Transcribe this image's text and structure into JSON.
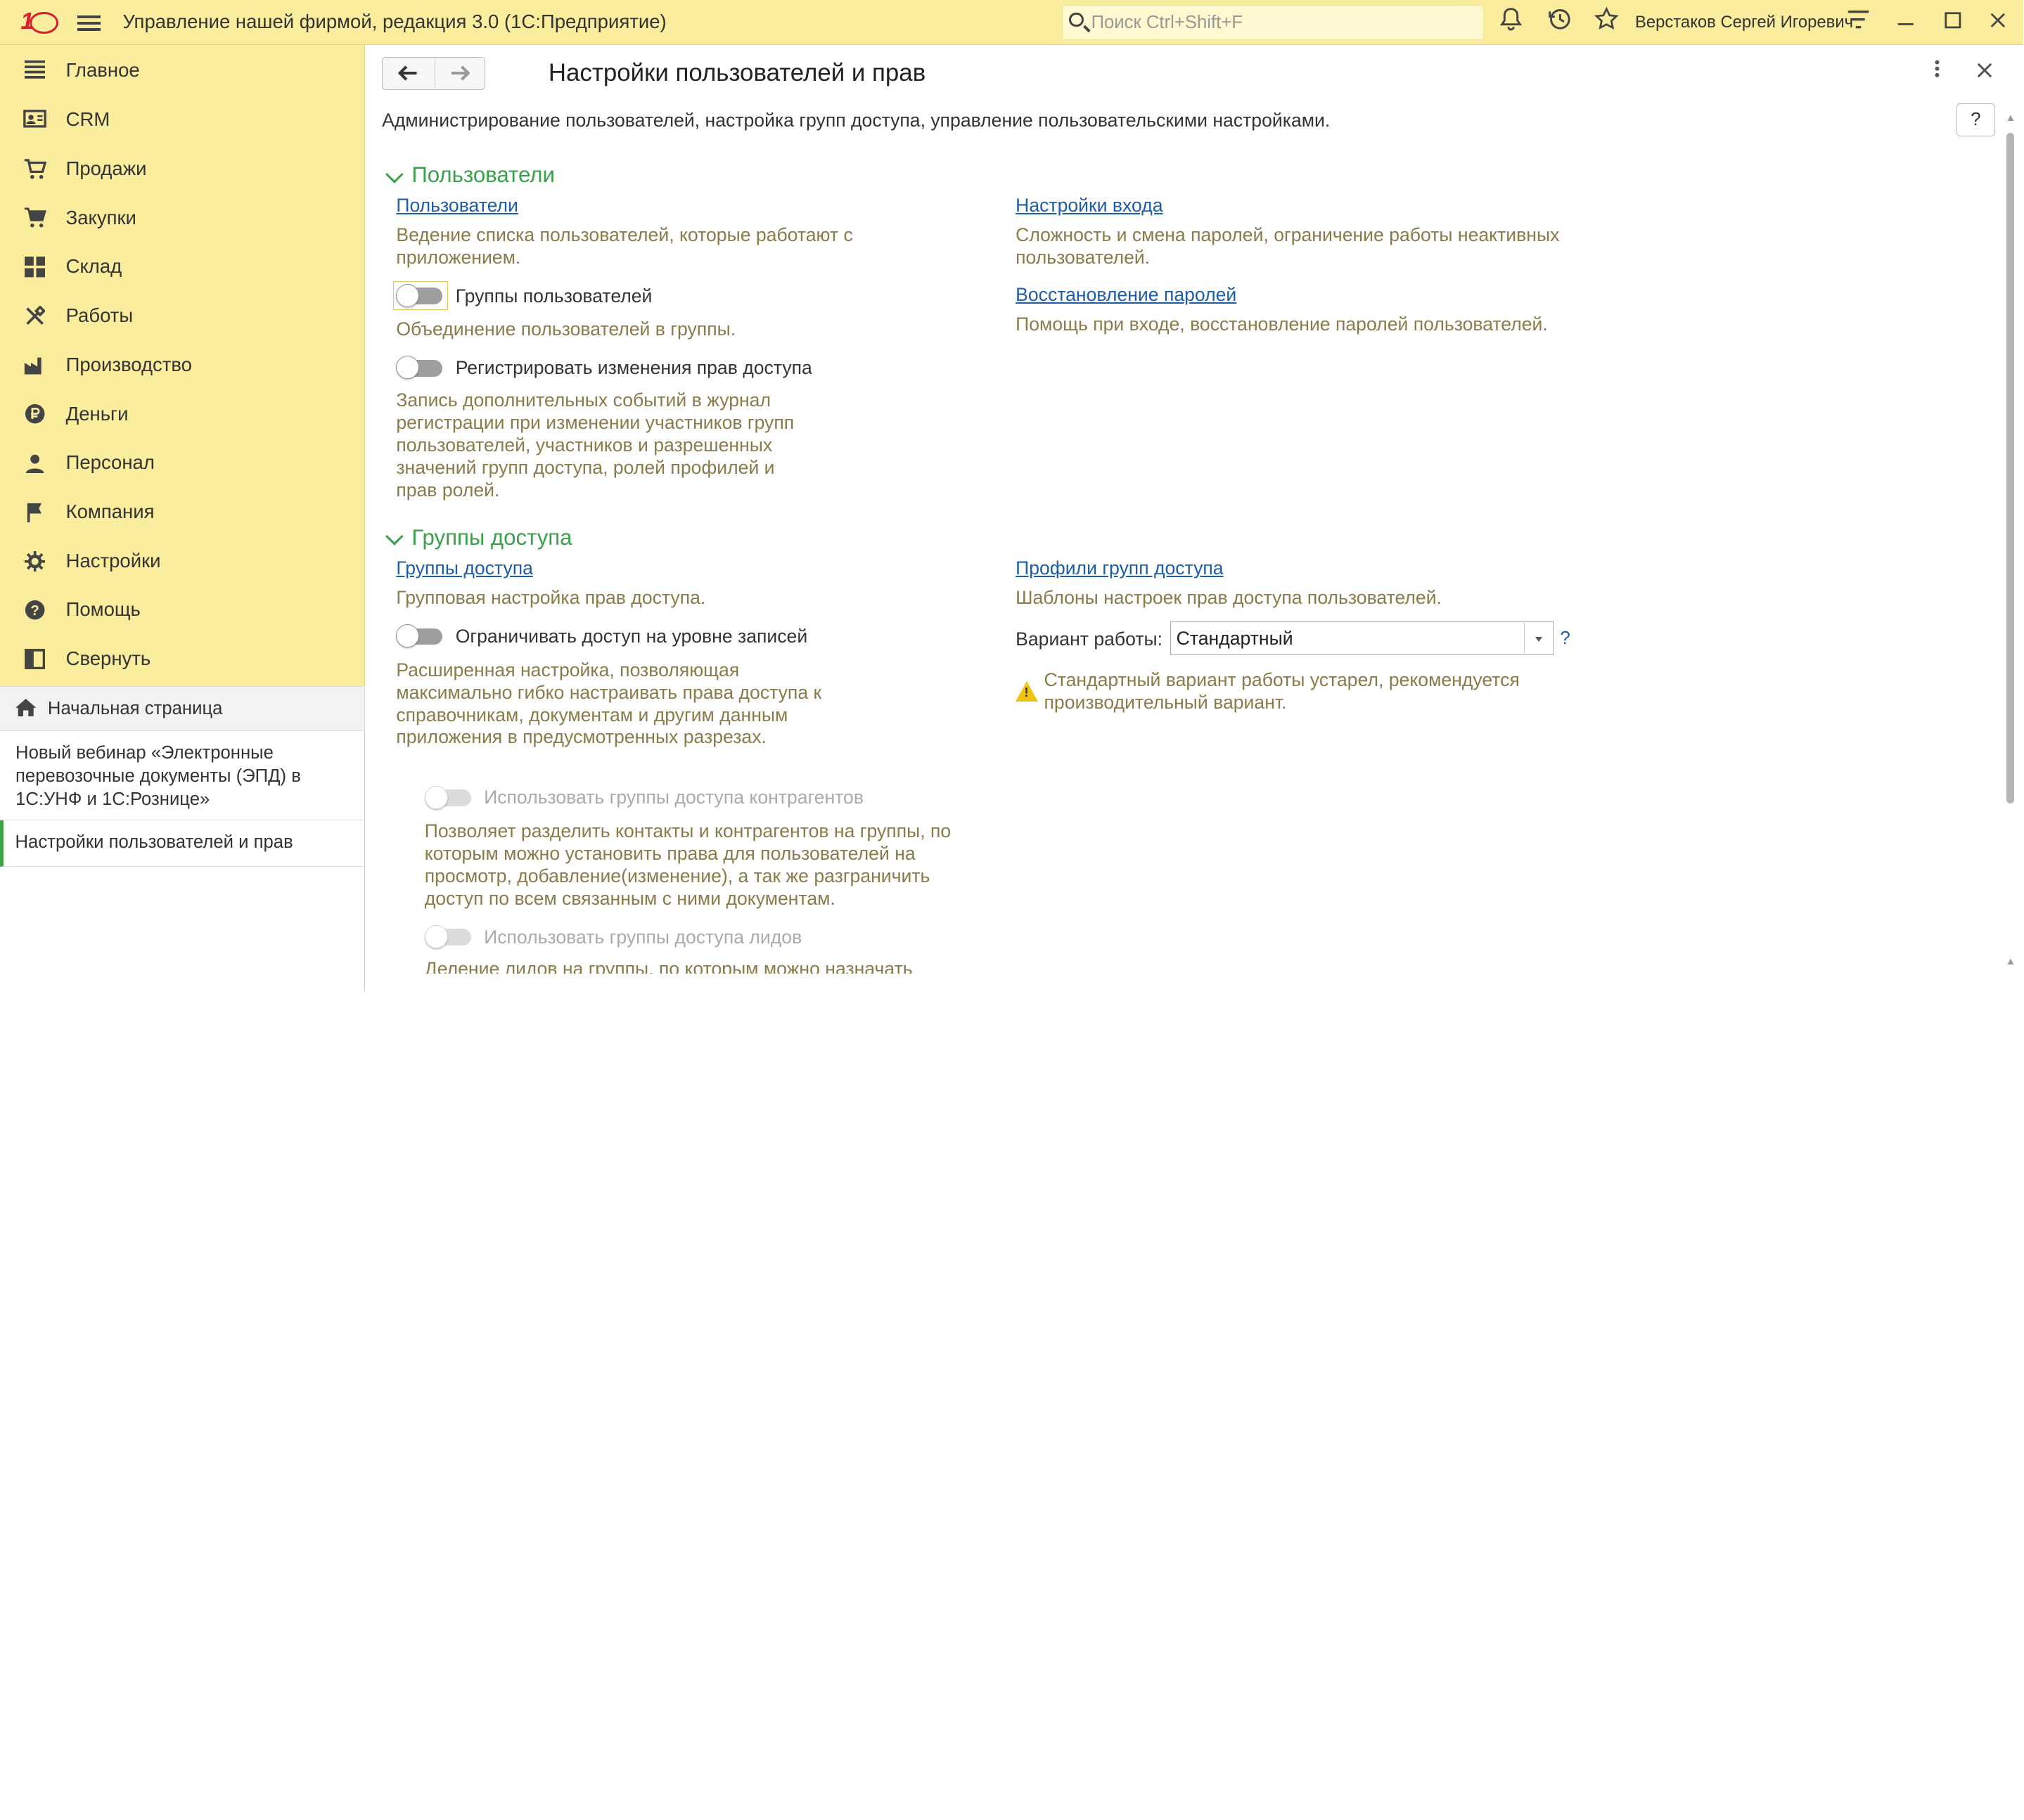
{
  "titlebar": {
    "app_title": "Управление нашей фирмой, редакция 3.0  (1С:Предприятие)",
    "search_placeholder": "Поиск Ctrl+Shift+F",
    "user_name": "Верстаков Сергей Игоревич",
    "logo_text": "1С"
  },
  "sidebar": {
    "items": [
      {
        "label": "Главное",
        "icon": "menu-lines-icon"
      },
      {
        "label": "CRM",
        "icon": "contact-card-icon"
      },
      {
        "label": "Продажи",
        "icon": "cart-icon"
      },
      {
        "label": "Закупки",
        "icon": "purchase-cart-icon"
      },
      {
        "label": "Склад",
        "icon": "warehouse-icon"
      },
      {
        "label": "Работы",
        "icon": "tools-icon"
      },
      {
        "label": "Производство",
        "icon": "factory-icon"
      },
      {
        "label": "Деньги",
        "icon": "ruble-icon"
      },
      {
        "label": "Персонал",
        "icon": "person-icon"
      },
      {
        "label": "Компания",
        "icon": "flag-icon"
      },
      {
        "label": "Настройки",
        "icon": "gear-icon"
      },
      {
        "label": "Помощь",
        "icon": "help-icon"
      },
      {
        "label": "Свернуть",
        "icon": "collapse-icon"
      }
    ]
  },
  "open_windows": {
    "home": "Начальная страница",
    "items": [
      "Новый вебинар «Электронные перевозочные документы (ЭПД) в 1С:УНФ и 1С:Рознице»",
      "Настройки пользователей и прав"
    ]
  },
  "main": {
    "title": "Настройки пользователей и прав",
    "description": "Администрирование пользователей, настройка групп доступа, управление пользовательскими настройками.",
    "help_label": "?",
    "sections": {
      "users": {
        "title": "Пользователи",
        "users_link": "Пользователи",
        "users_hint": "Ведение списка пользователей, которые работают с приложением.",
        "groups_toggle": "Группы пользователей",
        "groups_hint": "Объединение пользователей в группы.",
        "register_toggle": "Регистрировать изменения прав доступа",
        "register_hint": "Запись дополнительных событий в журнал регистрации при изменении участников групп пользователей, участников и разрешенных значений групп доступа, ролей профилей и прав ролей.",
        "login_link": "Настройки входа",
        "login_hint": "Сложность и смена паролей, ограничение работы неактивных пользователей.",
        "restore_link": "Восстановление паролей",
        "restore_hint": "Помощь при входе, восстановление паролей пользователей."
      },
      "access": {
        "title": "Группы доступа",
        "groups_link": "Группы доступа",
        "groups_hint": "Групповая настройка прав доступа.",
        "restrict_toggle": "Ограничивать доступ на уровне записей",
        "restrict_hint": "Расширенная настройка, позволяющая максимально гибко настраивать права доступа к справочникам, документам и другим данным приложения в предусмотренных разрезах.",
        "contractors_toggle": "Использовать группы доступа контрагентов",
        "contractors_hint": "Позволяет разделить контакты и контрагентов на группы, по которым можно установить права для пользователей на просмотр, добавление(изменение), а так же разграничить доступ по всем связанным с ними документам.",
        "leads_toggle": "Использовать группы доступа лидов",
        "leads_hint": "Деление лидов на группы, по которым можно назначать",
        "profiles_link": "Профили групп доступа",
        "profiles_hint": "Шаблоны настроек прав доступа пользователей.",
        "mode_label": "Вариант работы:",
        "mode_value": "Стандартный",
        "mode_help": "?",
        "warning": "Стандартный вариант работы устарел, рекомендуется производительный вариант."
      }
    }
  },
  "colors": {
    "titlebar_bg": "#fbed9e",
    "section_green": "#3aa04a",
    "link_blue": "#1d5da8",
    "hint_text": "#8a7b4a"
  }
}
